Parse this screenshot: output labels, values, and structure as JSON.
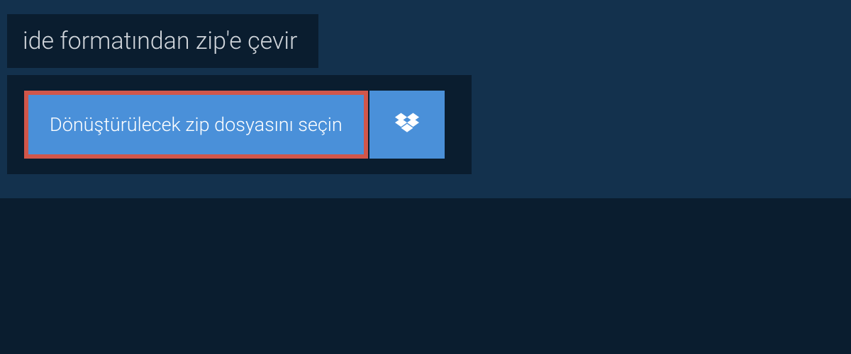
{
  "header": {
    "title": "ide formatından zip'e çevir"
  },
  "actions": {
    "select_file_label": "Dönüştürülecek zip dosyasını seçin",
    "dropbox_icon": "dropbox-icon"
  },
  "colors": {
    "bg_outer": "#13314d",
    "bg_panel": "#0a1d2f",
    "button_blue": "#4a90d9",
    "button_border": "#d1564a",
    "text_light": "#d0d5db"
  }
}
